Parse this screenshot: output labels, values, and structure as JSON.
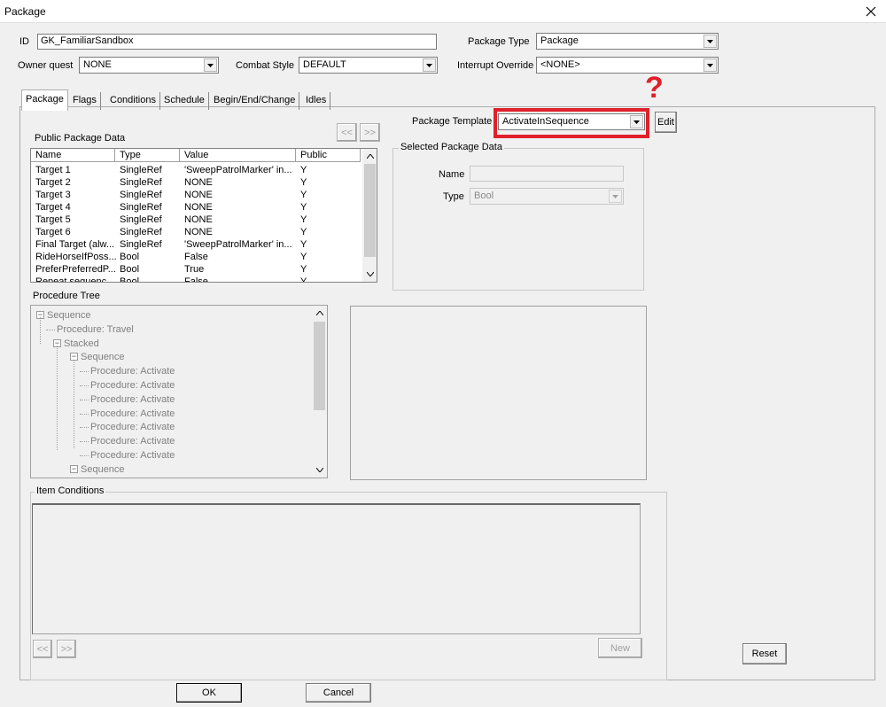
{
  "window": {
    "title": "Package"
  },
  "fields": {
    "id_label": "ID",
    "id_value": "GK_FamiliarSandbox",
    "package_type_label": "Package Type",
    "package_type_value": "Package",
    "owner_quest_label": "Owner quest",
    "owner_quest_value": "NONE",
    "combat_style_label": "Combat Style",
    "combat_style_value": "DEFAULT",
    "interrupt_override_label": "Interrupt Override",
    "interrupt_override_value": "<NONE>"
  },
  "tabs": [
    {
      "label": "Package"
    },
    {
      "label": "Flags"
    },
    {
      "label": "Conditions"
    },
    {
      "label": "Schedule"
    },
    {
      "label": "Begin/End/Change"
    },
    {
      "label": "Idles"
    }
  ],
  "template": {
    "label": "Package Template",
    "value": "ActivateInSequence",
    "edit_label": "Edit",
    "annotation": "?"
  },
  "public_data": {
    "title": "Public Package Data",
    "prev_label": "<<",
    "next_label": ">>",
    "columns": [
      "Name",
      "Type",
      "Value",
      "Public"
    ],
    "rows": [
      {
        "name": "Target 1",
        "type": "SingleRef",
        "value": "'SweepPatrolMarker' in...",
        "public": "Y"
      },
      {
        "name": "Target 2",
        "type": "SingleRef",
        "value": " NONE",
        "public": "Y"
      },
      {
        "name": "Target 3",
        "type": "SingleRef",
        "value": " NONE",
        "public": "Y"
      },
      {
        "name": "Target 4",
        "type": "SingleRef",
        "value": " NONE",
        "public": "Y"
      },
      {
        "name": "Target 5",
        "type": "SingleRef",
        "value": " NONE",
        "public": "Y"
      },
      {
        "name": "Target 6",
        "type": "SingleRef",
        "value": " NONE",
        "public": "Y"
      },
      {
        "name": "Final Target (alw...",
        "type": "SingleRef",
        "value": "'SweepPatrolMarker' in...",
        "public": "Y"
      },
      {
        "name": "RideHorseIfPoss...",
        "type": "Bool",
        "value": "False",
        "public": "Y"
      },
      {
        "name": "PreferPreferredP...",
        "type": "Bool",
        "value": "True",
        "public": "Y"
      },
      {
        "name": "Repeat sequenc...",
        "type": "Bool",
        "value": "False",
        "public": "Y"
      }
    ]
  },
  "selected_data": {
    "title": "Selected Package Data",
    "name_label": "Name",
    "name_value": "",
    "type_label": "Type",
    "type_value": "Bool"
  },
  "procedure_tree": {
    "title": "Procedure Tree",
    "expander": "−",
    "nodes": [
      "Sequence",
      "Procedure: Travel",
      "Stacked",
      "Sequence",
      "Procedure: Activate",
      "Procedure: Activate",
      "Procedure: Activate",
      "Procedure: Activate",
      "Procedure: Activate",
      "Procedure: Activate",
      "Procedure: Activate",
      "Sequence"
    ]
  },
  "item_conditions": {
    "title": "Item Conditions",
    "prev_label": "<<",
    "next_label": ">>",
    "new_label": "New"
  },
  "buttons": {
    "reset": "Reset",
    "ok": "OK",
    "cancel": "Cancel"
  },
  "icons": {
    "close": "close-icon",
    "dropdown": "chevron-down-icon",
    "scroll_up": "scroll-up-icon",
    "scroll_down": "scroll-down-icon",
    "collapse": "collapse-box-icon"
  },
  "colors": {
    "highlight": "#e0202a",
    "window_bg": "#f0f0f0"
  }
}
